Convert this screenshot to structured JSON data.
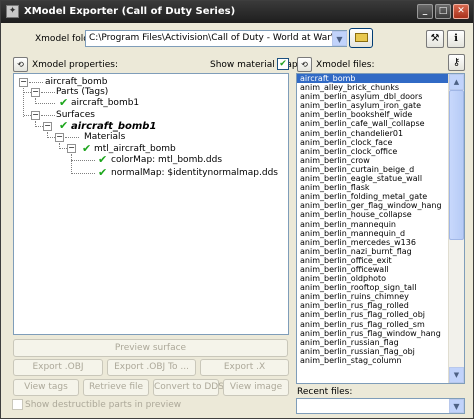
{
  "window": {
    "title": "XModel Exporter (Call of Duty Series)",
    "minimize": "_",
    "maximize": "□",
    "close": "✕"
  },
  "folder": {
    "label": "Xmodel folder:",
    "path": "C:\\Program Files\\Activision\\Call of Duty - World at War\\raw\\xmodel"
  },
  "properties": {
    "label": "Xmodel properties:",
    "show_maps_label": "Show material maps",
    "show_maps_checked": true,
    "tree": {
      "root": "aircraft_bomb",
      "parts": "Parts (Tags)",
      "part1": "aircraft_bomb1",
      "surfaces": "Surfaces",
      "surface1": "aircraft_bomb1",
      "materials": "Materials",
      "material1": "mtl_aircraft_bomb",
      "colormap": "colorMap: mtl_bomb.dds",
      "normalmap": "normalMap: $identitynormalmap.dds"
    }
  },
  "files": {
    "label": "Xmodel files:",
    "items": [
      "aircraft_bomb",
      "anim_alley_brick_chunks",
      "anim_berlin_asylum_dbl_doors",
      "anim_berlin_asylum_iron_gate",
      "anim_berlin_bookshelf_wide",
      "anim_berlin_cafe_wall_collapse",
      "anim_berlin_chandelier01",
      "anim_berlin_clock_face",
      "anim_berlin_clock_office",
      "anim_berlin_crow",
      "anim_berlin_curtain_beige_d",
      "anim_berlin_eagle_statue_wall",
      "anim_berlin_flask",
      "anim_berlin_folding_metal_gate",
      "anim_berlin_ger_flag_window_hang",
      "anim_berlin_house_collapse",
      "anim_berlin_mannequin",
      "anim_berlin_mannequin_d",
      "anim_berlin_mercedes_w136",
      "anim_berlin_nazi_burnt_flag",
      "anim_berlin_office_exit",
      "anim_berlin_officewall",
      "anim_berlin_oldphoto",
      "anim_berlin_rooftop_sign_tall",
      "anim_berlin_ruins_chimney",
      "anim_berlin_rus_flag_rolled",
      "anim_berlin_rus_flag_rolled_obj",
      "anim_berlin_rus_flag_rolled_sm",
      "anim_berlin_rus_flag_window_hang",
      "anim_berlin_russian_flag",
      "anim_berlin_russian_flag_obj",
      "anim_berlin_stag_column"
    ],
    "selected_index": 0
  },
  "buttons": {
    "preview_surface": "Preview surface",
    "export_obj": "Export .OBJ",
    "export_obj_to": "Export .OBJ To ...",
    "export_x": "Export .X",
    "view_tags": "View tags",
    "retrieve_file": "Retrieve file",
    "convert_dds": "Convert to DDS",
    "view_image": "View image"
  },
  "destructible": {
    "label": "Show destructible parts in preview",
    "checked": false
  },
  "recent": {
    "label": "Recent files:",
    "value": ""
  }
}
